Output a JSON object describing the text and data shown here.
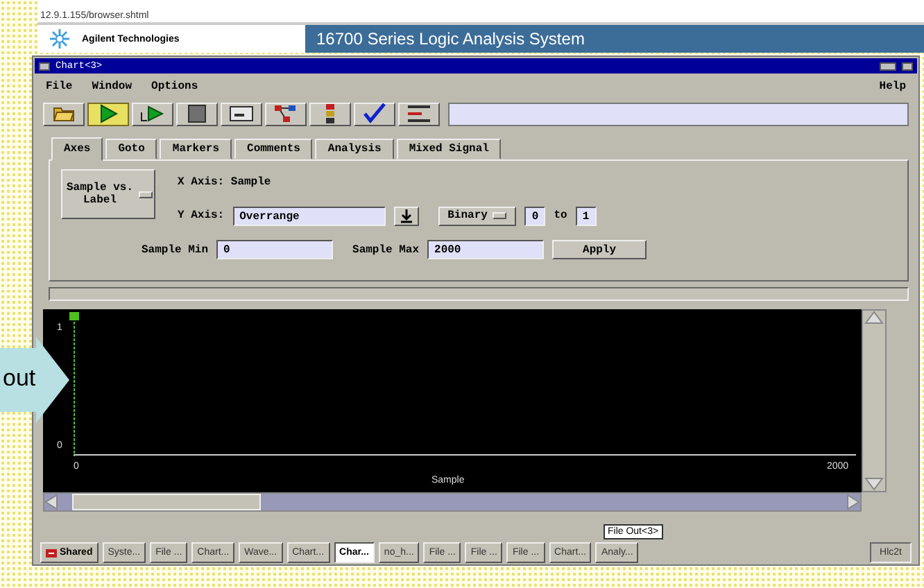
{
  "address_bar": {
    "url": "12.9.1.155/browser.shtml"
  },
  "banner": {
    "brand": "Agilent Technologies",
    "title": "16700 Series Logic Analysis System"
  },
  "window": {
    "title": "Chart<3>"
  },
  "menu": {
    "left": [
      "File",
      "Window",
      "Options"
    ],
    "right": "Help"
  },
  "toolbar": [
    {
      "kind": "folder",
      "highlighted": false
    },
    {
      "kind": "run",
      "highlighted": true
    },
    {
      "kind": "repeat",
      "highlighted": false
    },
    {
      "kind": "stop",
      "highlighted": false
    },
    {
      "kind": "panel",
      "highlighted": false
    },
    {
      "kind": "nodes",
      "highlighted": false
    },
    {
      "kind": "stack",
      "highlighted": false
    },
    {
      "kind": "check",
      "highlighted": false
    },
    {
      "kind": "list",
      "highlighted": false
    }
  ],
  "tabs": [
    {
      "label": "Axes",
      "selected": true
    },
    {
      "label": "Goto",
      "selected": false
    },
    {
      "label": "Markers",
      "selected": false
    },
    {
      "label": "Comments",
      "selected": false
    },
    {
      "label": "Analysis",
      "selected": false
    },
    {
      "label": "Mixed Signal",
      "selected": false
    }
  ],
  "axes_panel": {
    "mode_button": "Sample vs. Label",
    "x_axis": "X Axis: Sample",
    "y_axis_label": "Y Axis:",
    "y_axis_value": "Overrange",
    "format": "Binary",
    "range_from": "0",
    "range_to_label": "to",
    "range_to": "1",
    "min_label": "Sample Min",
    "min_value": "0",
    "max_label": "Sample Max",
    "max_value": "2000",
    "apply": "Apply"
  },
  "plot": {
    "y_ticks": [
      "1",
      "0"
    ],
    "x_ticks": [
      "0",
      "2000"
    ],
    "x_label": "Sample"
  },
  "taskbar": [
    {
      "label": "Shared",
      "selected": false,
      "kind": "shared"
    },
    {
      "label": "Syste...",
      "selected": false
    },
    {
      "label": "File ...",
      "selected": false
    },
    {
      "label": "Chart...",
      "selected": false
    },
    {
      "label": "Wave...",
      "selected": false
    },
    {
      "label": "Chart...",
      "selected": false
    },
    {
      "label": "Char...",
      "selected": true
    },
    {
      "label": "no_h...",
      "selected": false
    },
    {
      "label": "File ...",
      "selected": false
    },
    {
      "label": "File ...",
      "selected": false
    },
    {
      "label": "File ...",
      "selected": false
    },
    {
      "label": "Chart...",
      "selected": false
    },
    {
      "label": "Analy...",
      "selected": false
    }
  ],
  "taskbar_clock": "Hlc2t",
  "tooltip": "File Out<3>",
  "callout": {
    "text": "out"
  }
}
